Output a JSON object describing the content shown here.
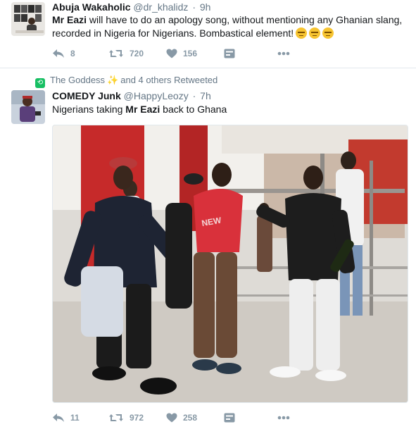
{
  "tweets": [
    {
      "author": {
        "name": "Abuja Wakaholic",
        "handle": "@dr_khalidz"
      },
      "time": "9h",
      "text": {
        "p1": "Mr Eazi",
        "p2": " will have to do an apology song, without mentioning any Ghanian slang, recorded in Nigeria for Nigerians. Bombastical element!"
      },
      "emojis": [
        "expressionless-face-icon",
        "expressionless-face-icon",
        "expressionless-face-icon"
      ],
      "actions": {
        "replies": "8",
        "retweets": "720",
        "likes": "156"
      }
    },
    {
      "context": {
        "name": "The Goddess",
        "suffix": "and 4 others Retweeted"
      },
      "author": {
        "name": "COMEDY Junk",
        "handle": "@HappyLeozy"
      },
      "time": "7h",
      "text": {
        "p1": "Nigerians taking ",
        "p2": "Mr Eazi",
        "p3": " back to Ghana"
      },
      "media": {
        "printed_text": "NEW"
      },
      "actions": {
        "replies": "11",
        "retweets": "972",
        "likes": "258"
      }
    }
  ],
  "icons": {
    "reply": "reply-icon",
    "retweet": "retweet-icon",
    "like": "heart-icon",
    "dm": "direct-message-icon",
    "more": "more-icon"
  },
  "colors": {
    "text": "#14171a",
    "secondary": "#657786",
    "action": "#8899a6",
    "retweet_green": "#17bf63",
    "divider": "#e1e8ed"
  }
}
